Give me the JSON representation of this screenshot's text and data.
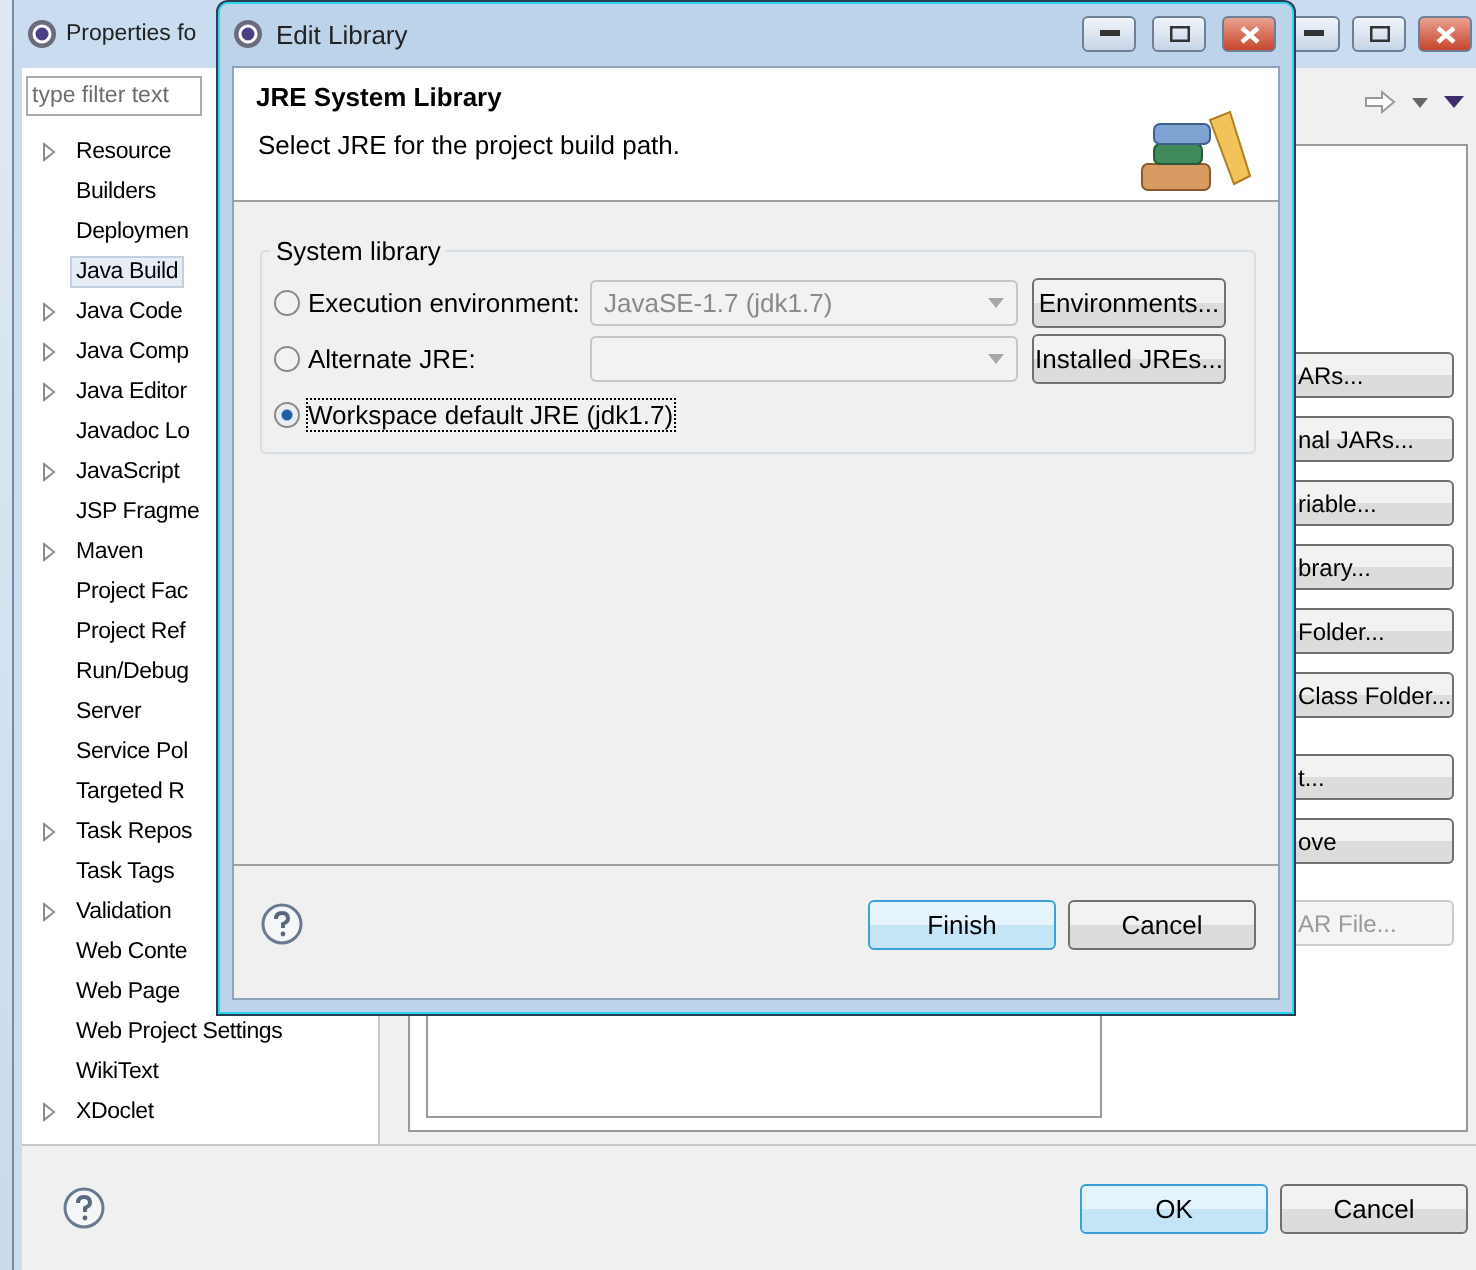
{
  "properties_window": {
    "title": "Properties fo",
    "filter": {
      "placeholder": "type filter text"
    },
    "tree_items": [
      {
        "label": "Resource",
        "expandable": true,
        "selected": false
      },
      {
        "label": "Builders",
        "expandable": false,
        "selected": false
      },
      {
        "label": "Deploymen",
        "expandable": false,
        "selected": false
      },
      {
        "label": "Java Build",
        "expandable": false,
        "selected": true
      },
      {
        "label": "Java Code",
        "expandable": true,
        "selected": false
      },
      {
        "label": "Java Comp",
        "expandable": true,
        "selected": false
      },
      {
        "label": "Java Editor",
        "expandable": true,
        "selected": false
      },
      {
        "label": "Javadoc Lo",
        "expandable": false,
        "selected": false
      },
      {
        "label": "JavaScript",
        "expandable": true,
        "selected": false
      },
      {
        "label": "JSP Fragme",
        "expandable": false,
        "selected": false
      },
      {
        "label": "Maven",
        "expandable": true,
        "selected": false
      },
      {
        "label": "Project Fac",
        "expandable": false,
        "selected": false
      },
      {
        "label": "Project Ref",
        "expandable": false,
        "selected": false
      },
      {
        "label": "Run/Debug",
        "expandable": false,
        "selected": false
      },
      {
        "label": "Server",
        "expandable": false,
        "selected": false
      },
      {
        "label": "Service Pol",
        "expandable": false,
        "selected": false
      },
      {
        "label": "Targeted R",
        "expandable": false,
        "selected": false
      },
      {
        "label": "Task Repos",
        "expandable": true,
        "selected": false
      },
      {
        "label": "Task Tags",
        "expandable": false,
        "selected": false
      },
      {
        "label": "Validation",
        "expandable": true,
        "selected": false
      },
      {
        "label": "Web Conte",
        "expandable": false,
        "selected": false
      },
      {
        "label": "Web Page",
        "expandable": false,
        "selected": false
      },
      {
        "label": "Web Project Settings",
        "expandable": false,
        "selected": false
      },
      {
        "label": "WikiText",
        "expandable": false,
        "selected": false
      },
      {
        "label": "XDoclet",
        "expandable": true,
        "selected": false
      }
    ],
    "side_buttons": [
      {
        "label": "ARs...",
        "disabled": false
      },
      {
        "label": "nal JARs...",
        "disabled": false
      },
      {
        "label": "riable...",
        "disabled": false
      },
      {
        "label": "brary...",
        "disabled": false
      },
      {
        "label": "Folder...",
        "disabled": false
      },
      {
        "label": "Class Folder...",
        "disabled": false
      },
      {
        "label": "t...",
        "disabled": false
      },
      {
        "label": "ove",
        "disabled": false
      },
      {
        "label": "AR File...",
        "disabled": true
      }
    ],
    "buttons": [
      {
        "label": "OK",
        "default": true
      },
      {
        "label": "Cancel",
        "default": false
      }
    ]
  },
  "dialog": {
    "title": "Edit Library",
    "header_title": "JRE System Library",
    "header_message": "Select JRE for the project build path.",
    "group_title": "System library",
    "options": [
      {
        "label": "Execution environment:",
        "selected": false,
        "combo": {
          "value": "JavaSE-1.7 (jdk1.7)",
          "disabled": true
        },
        "button": "Environments..."
      },
      {
        "label": "Alternate JRE:",
        "selected": false,
        "combo": {
          "disabled": true
        },
        "button": "Installed JREs..."
      },
      {
        "label": "Workspace default JRE (jdk1.7)",
        "selected": true
      }
    ],
    "buttons": [
      {
        "label": "Finish",
        "default": true
      },
      {
        "label": "Cancel",
        "default": false
      }
    ]
  }
}
